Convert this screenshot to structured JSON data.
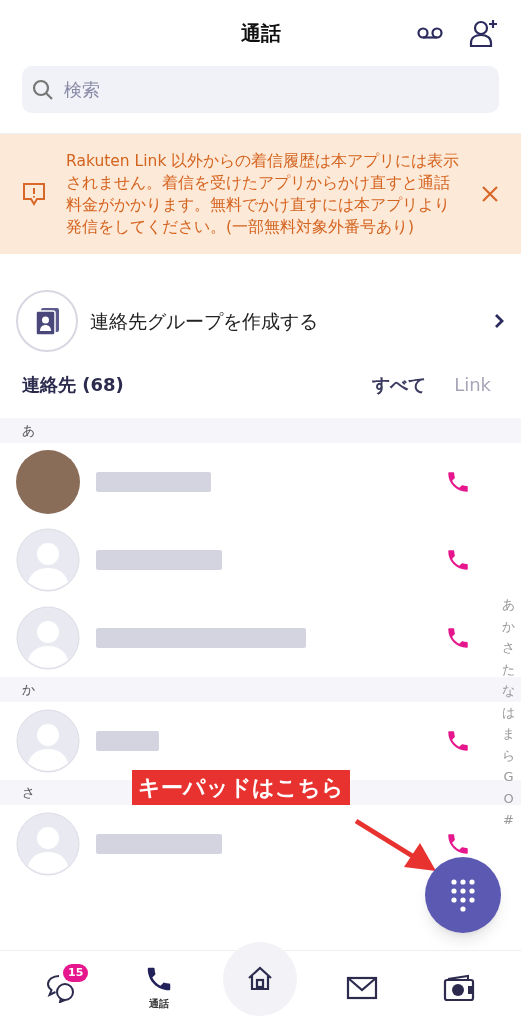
{
  "header": {
    "title": "通話"
  },
  "search": {
    "placeholder": "検索"
  },
  "notice": {
    "text": "Rakuten Link 以外からの着信履歴は本アプリには表示されません。着信を受けたアプリからかけ直すと通話料金がかかります。無料でかけ直すには本アプリより発信をしてください。(一部無料対象外番号あり)"
  },
  "create_group": {
    "label": "連絡先グループを作成する"
  },
  "contacts_header": {
    "title": "連絡先 (68)",
    "filters": [
      {
        "label": "すべて",
        "selected": true
      },
      {
        "label": "Link",
        "selected": false
      }
    ]
  },
  "sections": [
    {
      "heading": "あ",
      "contacts": [
        {
          "kind": "photo"
        },
        {
          "kind": "default"
        },
        {
          "kind": "default"
        }
      ]
    },
    {
      "heading": "か",
      "contacts": [
        {
          "kind": "default"
        }
      ]
    },
    {
      "heading": "さ",
      "contacts": [
        {
          "kind": "default"
        }
      ]
    }
  ],
  "index": [
    "あ",
    "か",
    "さ",
    "た",
    "な",
    "は",
    "ま",
    "ら",
    "G",
    "O",
    "#"
  ],
  "annotation": {
    "text": "キーパッドはこちら"
  },
  "tab_bar": [
    {
      "kind": "chat",
      "badge": "15",
      "selected": false
    },
    {
      "kind": "call",
      "label": "通話",
      "selected": true
    },
    {
      "kind": "home",
      "selected": false
    },
    {
      "kind": "mail",
      "selected": false
    },
    {
      "kind": "wallet",
      "selected": false
    }
  ]
}
